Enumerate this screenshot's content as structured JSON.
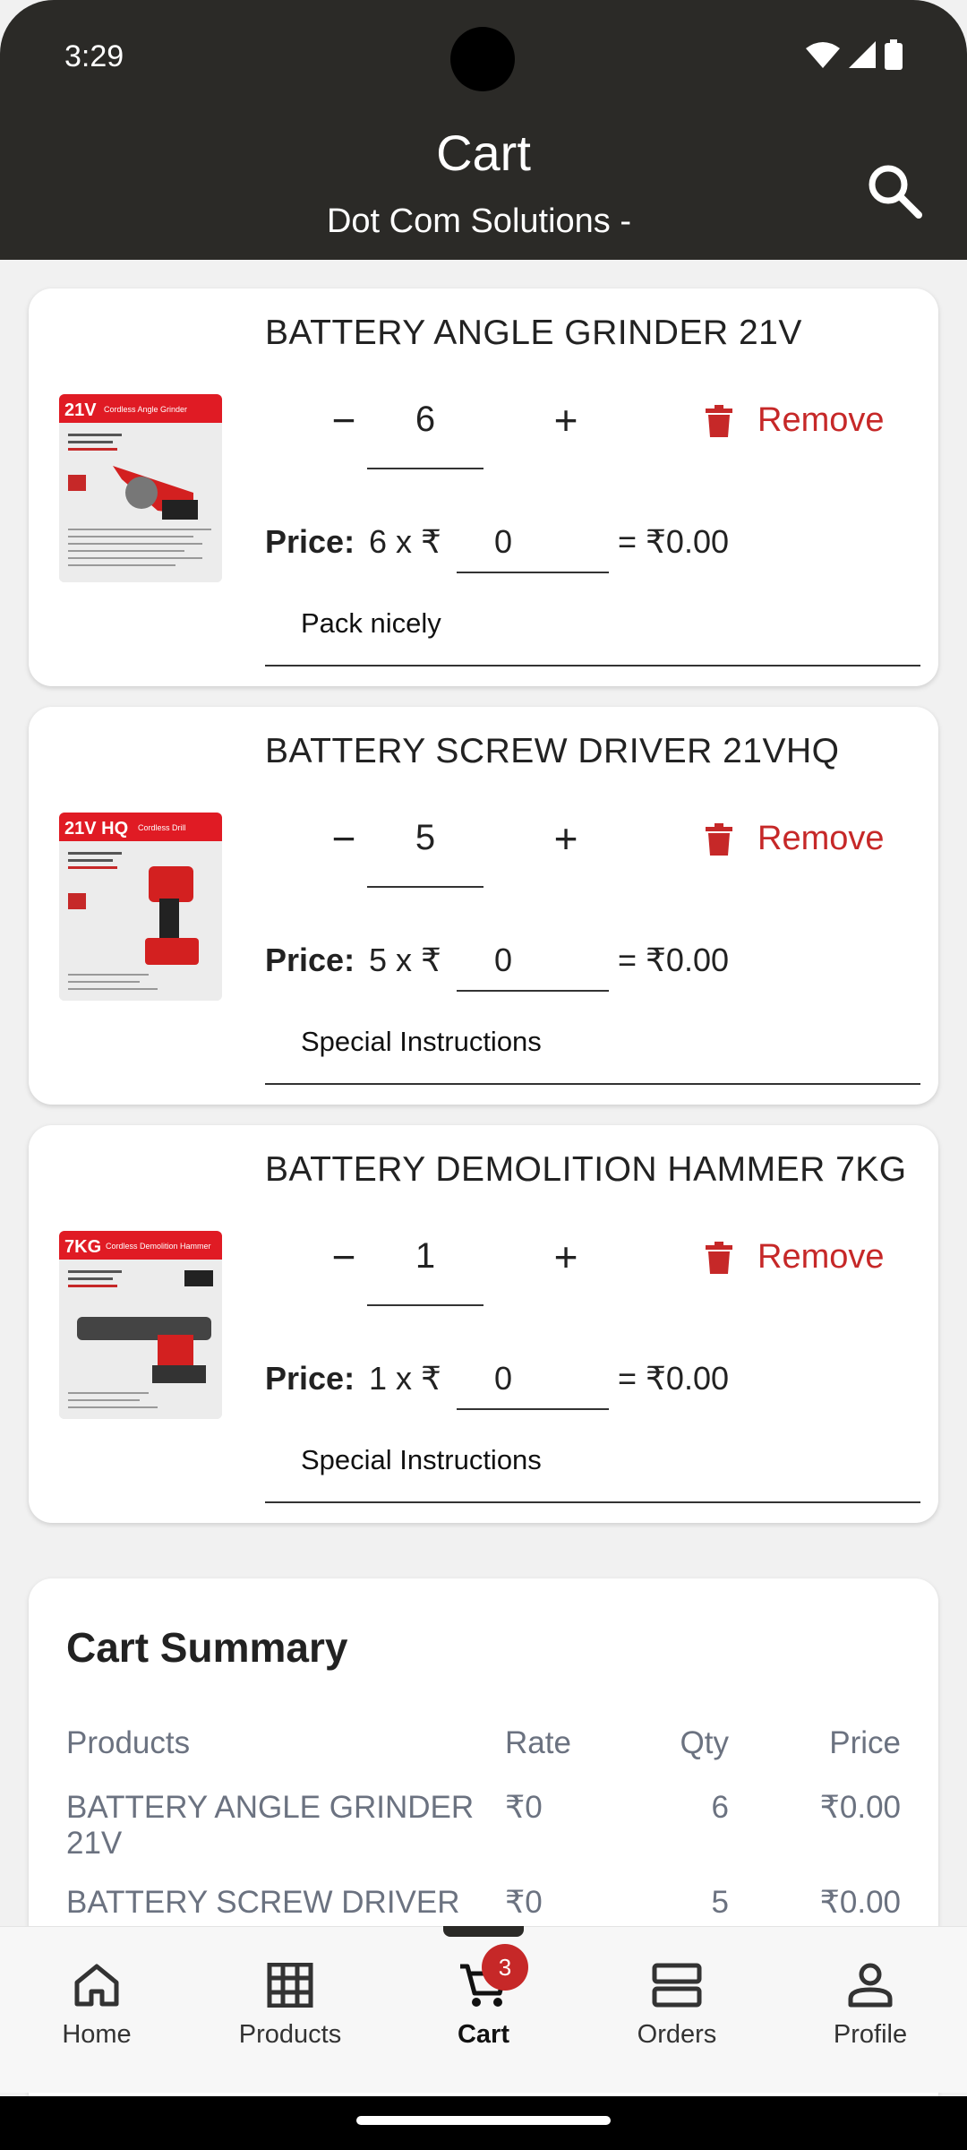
{
  "status": {
    "time": "3:29"
  },
  "header": {
    "title": "Cart",
    "subtitle": "Dot Com Solutions -"
  },
  "cart_items": [
    {
      "name": "BATTERY ANGLE GRINDER 21V",
      "qty": "6",
      "remove_label": "Remove",
      "price_label": "Price:",
      "price_mult": "6 x ₹",
      "price_value": "0",
      "price_total": "= ₹0.00",
      "instructions": "Pack nicely",
      "img_badge": "21V",
      "img_caption": "Cordless Angle Grinder"
    },
    {
      "name": "BATTERY SCREW DRIVER 21VHQ",
      "qty": "5",
      "remove_label": "Remove",
      "price_label": "Price:",
      "price_mult": "5 x ₹",
      "price_value": "0",
      "price_total": "= ₹0.00",
      "instructions": "Special Instructions",
      "img_badge": "21V HQ",
      "img_caption": "Cordless Drill"
    },
    {
      "name": "BATTERY DEMOLITION HAMMER 7KG",
      "qty": "1",
      "remove_label": "Remove",
      "price_label": "Price:",
      "price_mult": "1 x ₹",
      "price_value": "0",
      "price_total": "= ₹0.00",
      "instructions": "Special Instructions",
      "img_badge": "7KG",
      "img_caption": "Cordless Demolition Hammer"
    }
  ],
  "summary": {
    "title": "Cart Summary",
    "headers": {
      "product": "Products",
      "rate": "Rate",
      "qty": "Qty",
      "price": "Price"
    },
    "rows": [
      {
        "product": "BATTERY ANGLE GRINDER 21V",
        "rate": "₹0",
        "qty": "6",
        "price": "₹0.00"
      },
      {
        "product": "BATTERY SCREW DRIVER",
        "rate": "₹0",
        "qty": "5",
        "price": "₹0.00"
      }
    ]
  },
  "nav": {
    "items": [
      {
        "label": "Home",
        "icon": "home-icon"
      },
      {
        "label": "Products",
        "icon": "grid-icon"
      },
      {
        "label": "Cart",
        "icon": "cart-icon"
      },
      {
        "label": "Orders",
        "icon": "orders-icon"
      },
      {
        "label": "Profile",
        "icon": "person-icon"
      }
    ],
    "cart_badge": "3",
    "active": "Cart"
  },
  "colors": {
    "header_bg": "#2b2a27",
    "remove_red": "#c62828",
    "badge_red": "#c62828"
  }
}
